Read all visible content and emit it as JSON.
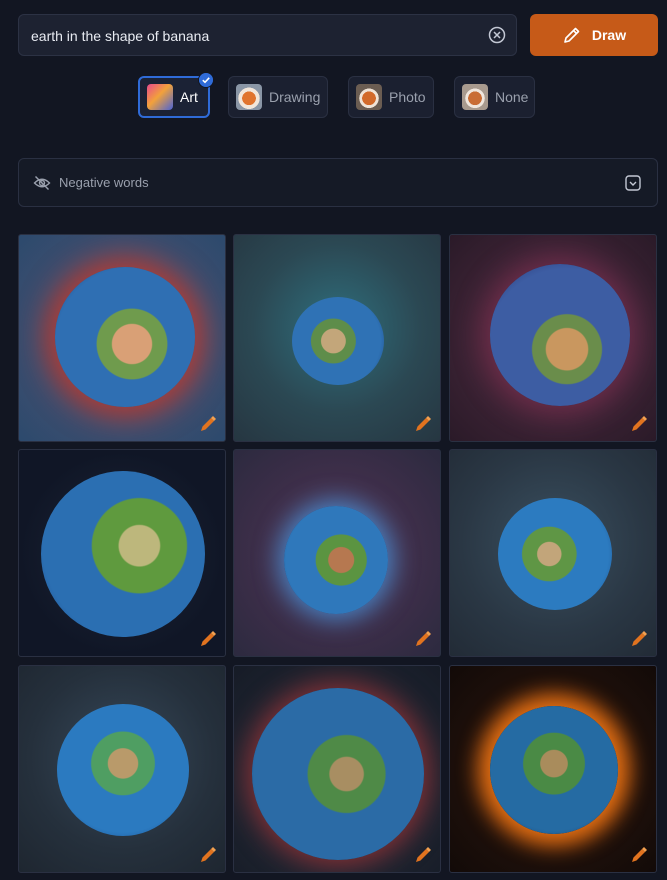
{
  "search": {
    "value": "earth in the shape of banana"
  },
  "draw_button": {
    "label": "Draw"
  },
  "styles": [
    {
      "label": "Art",
      "selected": true
    },
    {
      "label": "Drawing",
      "selected": false
    },
    {
      "label": "Photo",
      "selected": false
    },
    {
      "label": "None",
      "selected": false
    }
  ],
  "negative": {
    "label": "Negative words"
  },
  "colors": {
    "accent": "#c65a18",
    "selection": "#2f6bd8",
    "background": "#121622"
  },
  "icons": [
    "clear-icon",
    "pencil-icon",
    "check-icon",
    "eye-off-icon",
    "chevron-down-icon",
    "edit-icon"
  ]
}
